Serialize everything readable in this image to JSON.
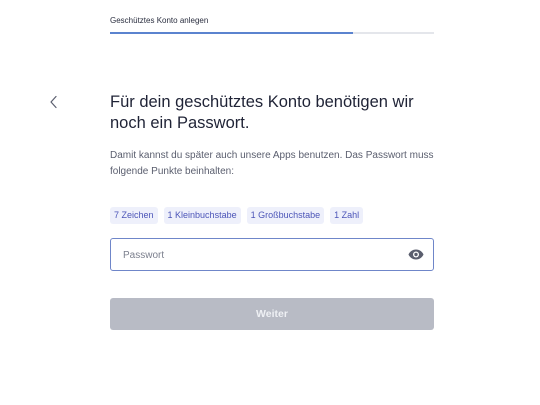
{
  "progress": {
    "label": "Geschütztes Konto anlegen",
    "fraction": 0.75
  },
  "icons": {
    "back": "chevron-left-icon",
    "visibility": "eye-icon"
  },
  "colors": {
    "accent": "#5b83cf",
    "chip_text": "#4c55b8",
    "chip_background": "#eef0fb",
    "button_disabled": "#b8bbc5"
  },
  "heading": "Für dein geschütztes Konto benötigen wir noch ein Passwort.",
  "description": "Damit kannst du später auch unsere Apps benutzen. Das Passwort muss folgende Punkte beinhalten:",
  "requirements": [
    {
      "label": "7 Zeichen"
    },
    {
      "label": "1 Kleinbuchstabe"
    },
    {
      "label": "1 Großbuchstabe"
    },
    {
      "label": "1 Zahl"
    }
  ],
  "password_field": {
    "value": "",
    "placeholder": "Passwort"
  },
  "submit": {
    "label": "Weiter",
    "state": "disabled"
  }
}
